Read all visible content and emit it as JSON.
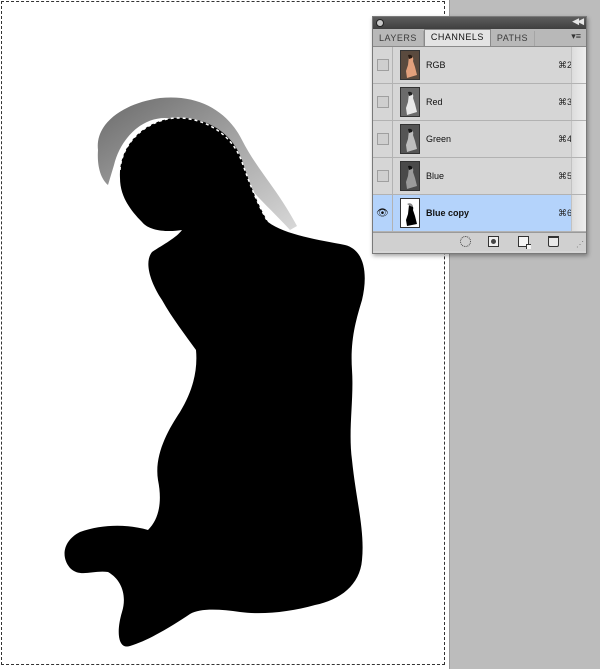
{
  "panel": {
    "tabs": [
      "LAYERS",
      "CHANNELS",
      "PATHS"
    ],
    "active_tab": "CHANNELS",
    "menu_icon": "panel-menu-icon",
    "collapse_icon": "collapse-icon"
  },
  "channels": [
    {
      "name": "RGB",
      "shortcut": "⌘2",
      "visible": false,
      "selected": false
    },
    {
      "name": "Red",
      "shortcut": "⌘3",
      "visible": false,
      "selected": false
    },
    {
      "name": "Green",
      "shortcut": "⌘4",
      "visible": false,
      "selected": false
    },
    {
      "name": "Blue",
      "shortcut": "⌘5",
      "visible": false,
      "selected": false
    },
    {
      "name": "Blue copy",
      "shortcut": "⌘6",
      "visible": true,
      "selected": true
    }
  ],
  "icons": {
    "eye": "eye-icon",
    "load_selection": "load-channel-as-selection-icon",
    "save_selection": "save-selection-as-channel-icon",
    "new_channel": "new-channel-icon",
    "delete_channel": "delete-channel-icon"
  },
  "colors": {
    "canvas": "#ffffff",
    "gutter": "#bcbcbc",
    "selected_row": "#b4d3fb",
    "silhouette": "#000000"
  }
}
